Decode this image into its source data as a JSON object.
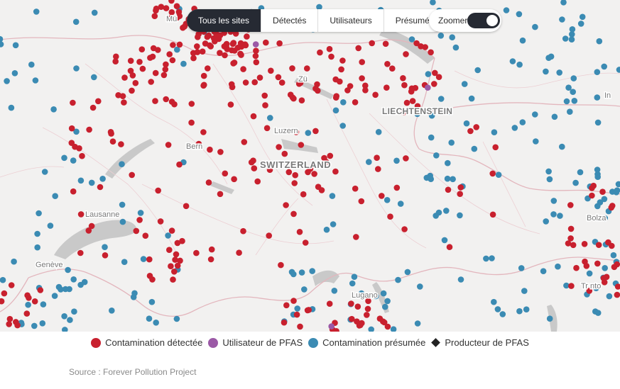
{
  "filters": {
    "all": "Tous les sites",
    "detected": "Détectés",
    "users": "Utilisateurs",
    "presumed": "Présumés"
  },
  "zoom": {
    "label": "Zoomer",
    "on": true
  },
  "map_labels": {
    "switzerland": "SWITZERLAND",
    "liechtenstein": "LIECHTENSTEIN",
    "luzern": "Luzern",
    "bern": "Bern",
    "zurich": "Zü",
    "lausanne": "Lausanne",
    "geneve": "Genève",
    "lugano": "Lugano",
    "bolzano": "Bolza",
    "trento": "Tr nto",
    "munich": "Mü",
    "innsbruck": "In"
  },
  "legend": {
    "detected": "Contamination détectée",
    "user": "Utilisateur de PFAS",
    "presumed": "Contamination présumée",
    "producer": "Producteur de PFAS"
  },
  "colors": {
    "detected": "#c8202e",
    "user": "#9b59a6",
    "presumed": "#3b8bb3",
    "producer": "#222222",
    "toggle": "#262a33"
  },
  "source": "Source : Forever Pollution Project"
}
